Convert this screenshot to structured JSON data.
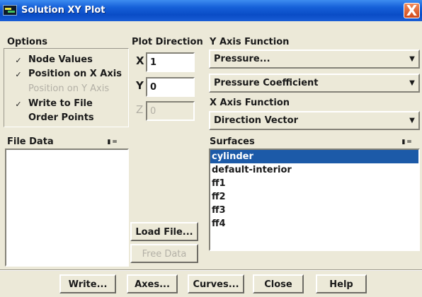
{
  "window": {
    "title": "Solution XY Plot",
    "close_glyph": "X"
  },
  "options": {
    "heading": "Options",
    "items": [
      {
        "label": "Node Values",
        "checked": true,
        "enabled": true,
        "mark": "✓"
      },
      {
        "label": "Position on X Axis",
        "checked": true,
        "enabled": true,
        "mark": "✓"
      },
      {
        "label": "Position on Y Axis",
        "checked": false,
        "enabled": false,
        "mark": ""
      },
      {
        "label": "Write to File",
        "checked": true,
        "enabled": true,
        "mark": "✓"
      },
      {
        "label": "Order Points",
        "checked": false,
        "enabled": true,
        "mark": ""
      }
    ]
  },
  "plot_direction": {
    "heading": "Plot Direction",
    "x_label": "X",
    "x_value": "1",
    "y_label": "Y",
    "y_value": "0",
    "z_label": "Z",
    "z_value": "0"
  },
  "y_axis": {
    "heading": "Y Axis Function",
    "category": "Pressure...",
    "quantity": "Pressure Coefficient"
  },
  "x_axis": {
    "heading": "X Axis Function",
    "value": "Direction Vector"
  },
  "file_data": {
    "heading": "File Data",
    "items": []
  },
  "surfaces": {
    "heading": "Surfaces",
    "items": [
      {
        "label": "cylinder",
        "selected": true
      },
      {
        "label": "default-interior",
        "selected": false
      },
      {
        "label": "ff1",
        "selected": false
      },
      {
        "label": "ff2",
        "selected": false
      },
      {
        "label": "ff3",
        "selected": false
      },
      {
        "label": "ff4",
        "selected": false
      }
    ]
  },
  "list_controls": {
    "all_glyph": "▮",
    "none_glyph": "="
  },
  "buttons": {
    "load_file": "Load File...",
    "free_data": "Free Data",
    "write": "Write...",
    "axes": "Axes...",
    "curves": "Curves...",
    "close": "Close",
    "help": "Help"
  },
  "colors": {
    "title_bar": "#0a4cc6",
    "selection": "#1c5aa8",
    "dialog_bg": "#ece9d8"
  }
}
